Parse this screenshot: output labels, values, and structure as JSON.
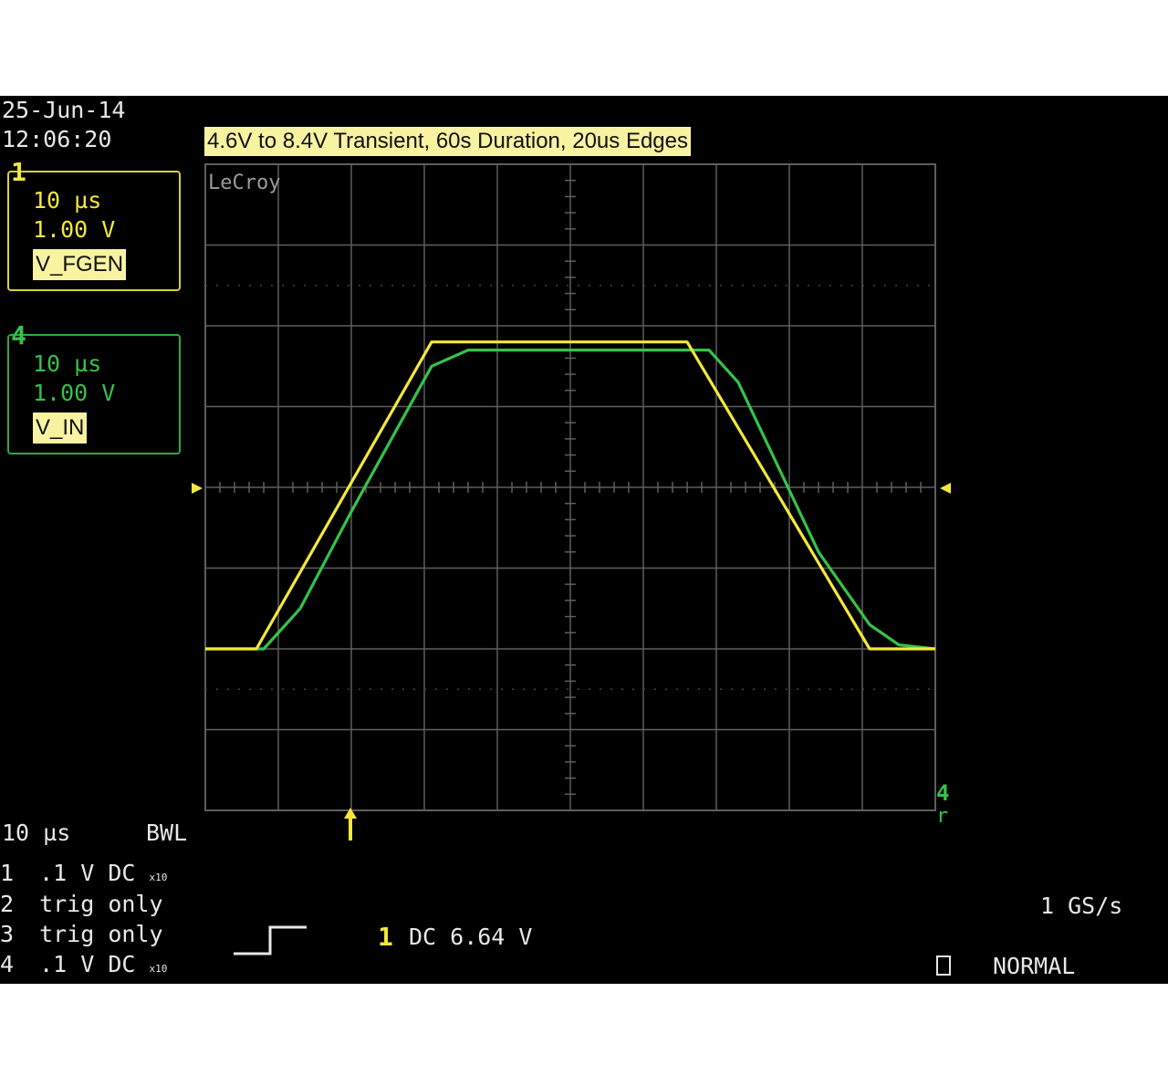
{
  "screen": {
    "date": "25-Jun-14",
    "time": "12:06:20",
    "title": "4.6V to 8.4V Transient, 60s Duration, 20us Edges",
    "brand": "LeCroy"
  },
  "channels": [
    {
      "number": "1",
      "timebase": "10 µs",
      "volts": "1.00 V",
      "label": "V_FGEN",
      "color": "#f4e83a"
    },
    {
      "number": "4",
      "timebase": "10 µs",
      "volts": "1.00 V",
      "label": "V_IN",
      "color": "#35c24a"
    }
  ],
  "status": {
    "timebase": "10 µs",
    "bwl": "BWL",
    "rows": [
      {
        "num": "1",
        "text": ".1  V  DC",
        "suffix": "x10"
      },
      {
        "num": "2",
        "text": "trig only",
        "suffix": ""
      },
      {
        "num": "3",
        "text": "trig only",
        "suffix": ""
      },
      {
        "num": "4",
        "text": ".1  V  DC",
        "suffix": "x10"
      }
    ],
    "trigger_channel": "1",
    "trigger_level": "DC 6.64 V",
    "sample_rate": "1 GS/s",
    "trigger_mode": "NORMAL"
  },
  "markers": {
    "right_channel": "4",
    "right_suffix": "r"
  },
  "chart_data": {
    "type": "line",
    "title": "4.6V to 8.4V Transient, 60s Duration, 20us Edges",
    "xlabel": "",
    "ylabel": "",
    "xlim": [
      0,
      10
    ],
    "ylim": [
      0,
      8
    ],
    "grid": true,
    "series": [
      {
        "name": "V_FGEN",
        "color": "#f4e83a",
        "x": [
          0,
          0.7,
          3.1,
          6.6,
          9.1,
          10
        ],
        "y": [
          2.0,
          2.0,
          5.8,
          5.8,
          2.0,
          2.0
        ]
      },
      {
        "name": "V_IN",
        "color": "#35c24a",
        "x": [
          0,
          0.8,
          1.3,
          2.0,
          3.1,
          3.6,
          6.9,
          7.3,
          8.4,
          9.1,
          9.5,
          10
        ],
        "y": [
          2.0,
          2.0,
          2.5,
          3.7,
          5.5,
          5.7,
          5.7,
          5.3,
          3.2,
          2.3,
          2.05,
          2.0
        ]
      }
    ]
  }
}
